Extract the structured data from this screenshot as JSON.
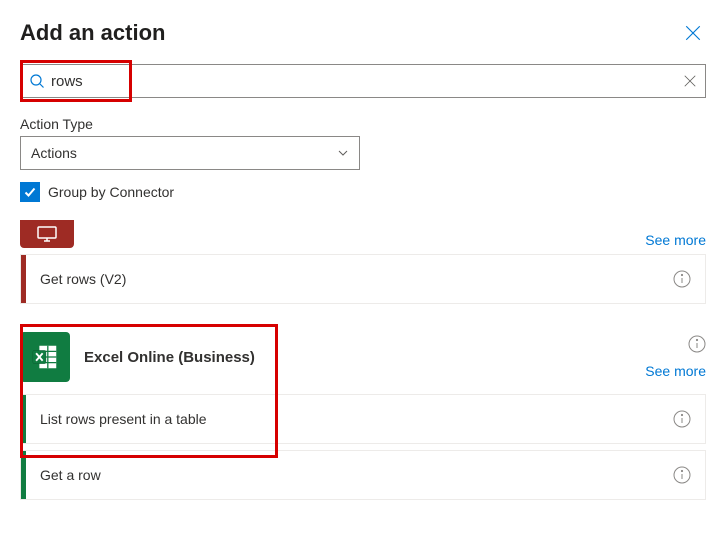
{
  "header": {
    "title": "Add an action"
  },
  "search": {
    "value": "rows"
  },
  "filter": {
    "action_type_label": "Action Type",
    "action_type_value": "Actions",
    "group_by_label": "Group by Connector"
  },
  "links": {
    "see_more": "See more"
  },
  "connectors": {
    "sql": {
      "actions": [
        {
          "label": "Get rows (V2)"
        }
      ]
    },
    "excel": {
      "name": "Excel Online (Business)",
      "actions": [
        {
          "label": "List rows present in a table"
        },
        {
          "label": "Get a row"
        }
      ]
    }
  }
}
